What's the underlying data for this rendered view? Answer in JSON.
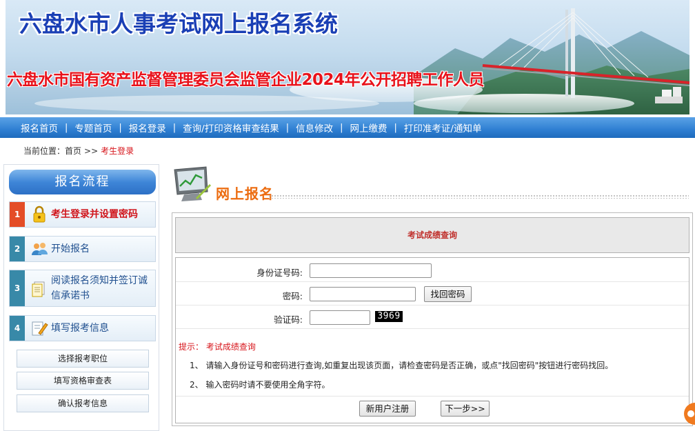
{
  "banner": {
    "title": "六盘水市人事考试网上报名系统",
    "subtitle": "六盘水市国有资产监督管理委员会监管企业2024年公开招聘工作人员"
  },
  "nav": {
    "items": [
      {
        "label": "报名首页"
      },
      {
        "label": "专题首页"
      },
      {
        "label": "报名登录"
      },
      {
        "label": "查询/打印资格审查结果"
      },
      {
        "label": "信息修改"
      },
      {
        "label": "网上缴费"
      },
      {
        "label": "打印准考证/通知单"
      }
    ],
    "separator": "|"
  },
  "breadcrumb": {
    "prefix": "当前位置：",
    "home": "首页",
    "arrow": ">>",
    "current": "考生登录"
  },
  "sidebar": {
    "title": "报名流程",
    "steps": [
      {
        "num": "1",
        "label": "考生登录并设置密码",
        "icon": "lock-icon",
        "active": true
      },
      {
        "num": "2",
        "label": "开始报名",
        "icon": "users-icon",
        "active": false
      },
      {
        "num": "3",
        "label": "阅读报名须知并签订诚信承诺书",
        "icon": "documents-icon",
        "active": false
      },
      {
        "num": "4",
        "label": "填写报考信息",
        "icon": "edit-icon",
        "active": false
      }
    ],
    "sub_items": [
      {
        "label": "选择报考职位"
      },
      {
        "label": "填写资格审查表"
      },
      {
        "label": "确认报考信息"
      }
    ]
  },
  "main": {
    "heading": "网上报名",
    "query_title": "考试成绩查询",
    "form": {
      "id_label": "身份证号码:",
      "id_value": "",
      "password_label": "密码:",
      "password_value": "",
      "find_password_button": "找回密码",
      "captcha_label": "验证码:",
      "captcha_value": "",
      "captcha_code": "3969"
    },
    "tips": {
      "title": "提示：  考试成绩查询",
      "lines": [
        "1、 请输入身份证号和密码进行查询,如重复出现该页面，请检查密码是否正确，或点\"找回密码\"按钮进行密码找回。",
        "2、 输入密码时请不要使用全角字符。"
      ]
    },
    "register_button": "新用户注册",
    "next_button": "下一步>>"
  },
  "colors": {
    "nav_blue": "#2f7fd2",
    "title_blue": "#1a3fb5",
    "subtitle_red": "#e8121b",
    "heading_orange": "#ec6c10",
    "active_red": "#d0141b",
    "step_num_teal": "#3889a8",
    "step_num_active": "#e44d27"
  }
}
